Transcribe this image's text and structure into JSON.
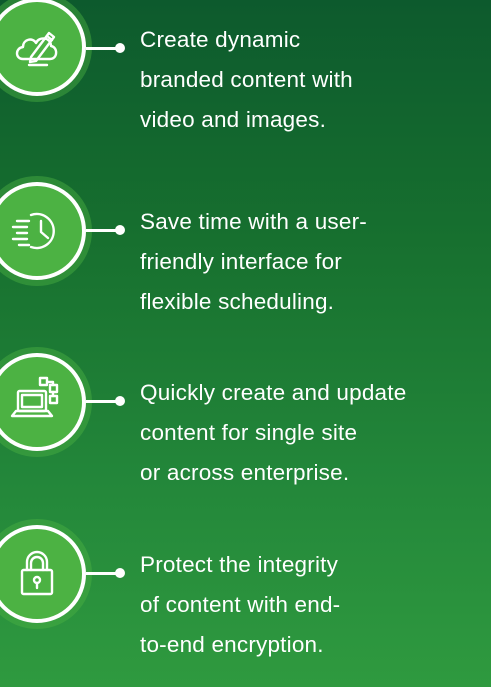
{
  "features": [
    {
      "icon": "cloud-pencil-icon",
      "lines": [
        "Create dynamic",
        "branded content with",
        "video and images."
      ]
    },
    {
      "icon": "fast-clock-icon",
      "lines": [
        "Save time with a user-",
        "friendly interface for",
        "flexible scheduling."
      ]
    },
    {
      "icon": "laptop-network-icon",
      "lines": [
        "Quickly create and update",
        "content for single site",
        "or across enterprise."
      ]
    },
    {
      "icon": "padlock-icon",
      "lines": [
        "Protect the integrity",
        "of content with end-",
        "to-end encryption."
      ]
    }
  ],
  "colors": {
    "background_top": "#0d5a2d",
    "background_bottom": "#2f9a3f",
    "icon_fill": "#4cb243",
    "text": "#ffffff"
  }
}
